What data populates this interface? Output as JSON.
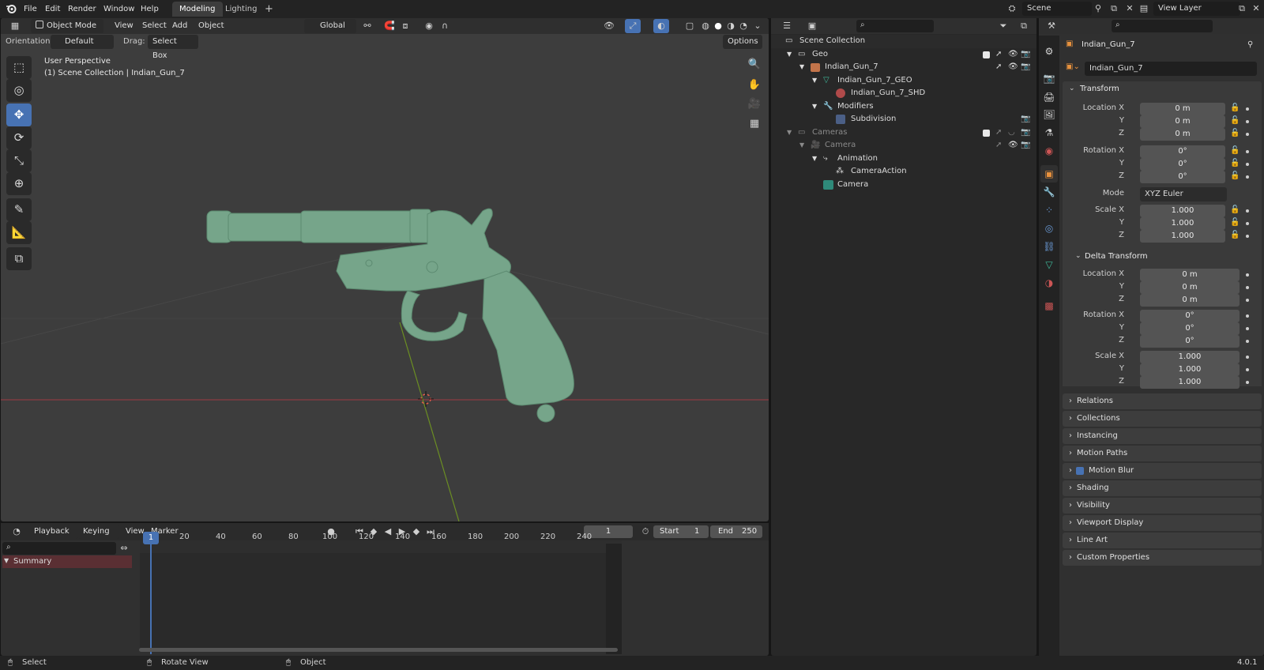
{
  "topbar": {
    "menu": [
      "File",
      "Edit",
      "Render",
      "Window",
      "Help"
    ],
    "tabs": [
      "Modeling",
      "Lighting"
    ],
    "add_tab": "+",
    "scene": "Scene",
    "view_layer": "View Layer"
  },
  "viewport": {
    "mode": "Object Mode",
    "menus": [
      "View",
      "Select",
      "Add",
      "Object"
    ],
    "transform_orientation": "Global",
    "orientation_label": "Orientation:",
    "orientation_value": "Default",
    "drag_label": "Drag:",
    "drag_value": "Select Box",
    "options": "Options",
    "overlay_line1": "User Perspective",
    "overlay_line2": "(1) Scene Collection | Indian_Gun_7"
  },
  "colors": {
    "model": "#76a58a",
    "accent": "#4772b3",
    "x_axis": "#9e3a44",
    "y_axis": "#6b8e23"
  },
  "outliner": {
    "rows": [
      {
        "label": "Scene Collection",
        "icon": "collection-icon"
      },
      {
        "label": "Geo"
      },
      {
        "label": "Indian_Gun_7"
      },
      {
        "label": "Indian_Gun_7_GEO"
      },
      {
        "label": "Indian_Gun_7_SHD"
      },
      {
        "label": "Modifiers"
      },
      {
        "label": "Subdivision"
      },
      {
        "label": "Cameras"
      },
      {
        "label": "Camera"
      },
      {
        "label": "Animation"
      },
      {
        "label": "CameraAction"
      },
      {
        "label": "Camera"
      }
    ]
  },
  "properties": {
    "object_name": "Indian_Gun_7",
    "name_field": "Indian_Gun_7",
    "transform_title": "Transform",
    "location_x_label": "Location X",
    "y_label": "Y",
    "z_label": "Z",
    "location": [
      "0 m",
      "0 m",
      "0 m"
    ],
    "rotation_x_label": "Rotation X",
    "rotation": [
      "0°",
      "0°",
      "0°"
    ],
    "mode_label": "Mode",
    "mode_value": "XYZ Euler",
    "scale_x_label": "Scale X",
    "scale": [
      "1.000",
      "1.000",
      "1.000"
    ],
    "delta_title": "Delta Transform",
    "delta_location": [
      "0 m",
      "0 m",
      "0 m"
    ],
    "delta_rotation": [
      "0°",
      "0°",
      "0°"
    ],
    "delta_scale": [
      "1.000",
      "1.000",
      "1.000"
    ],
    "subpanels": [
      "Relations",
      "Collections",
      "Instancing",
      "Motion Paths",
      "Motion Blur",
      "Shading",
      "Visibility",
      "Viewport Display",
      "Line Art",
      "Custom Properties"
    ]
  },
  "timeline": {
    "menus": [
      "Playback",
      "Keying",
      "View",
      "Marker"
    ],
    "current_frame": "1",
    "start_label": "Start",
    "start": "1",
    "end_label": "End",
    "end": "250",
    "summary": "Summary",
    "ticks": [
      "1",
      "20",
      "40",
      "60",
      "80",
      "100",
      "120",
      "140",
      "160",
      "180",
      "200",
      "220",
      "240"
    ]
  },
  "statusbar": {
    "select": "Select",
    "rotate_view": "Rotate View",
    "object": "Object",
    "version": "4.0.1"
  }
}
